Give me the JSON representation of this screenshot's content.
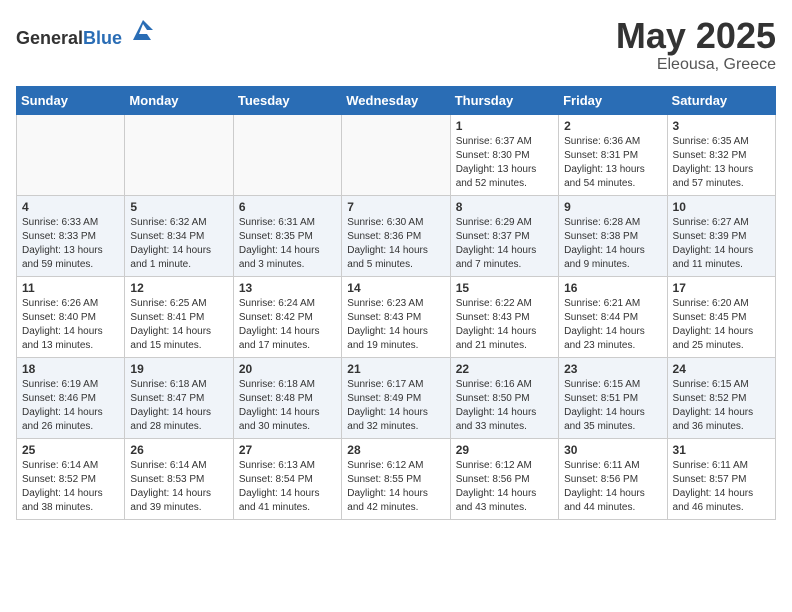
{
  "header": {
    "logo_general": "General",
    "logo_blue": "Blue",
    "month_year": "May 2025",
    "location": "Eleousa, Greece"
  },
  "days_of_week": [
    "Sunday",
    "Monday",
    "Tuesday",
    "Wednesday",
    "Thursday",
    "Friday",
    "Saturday"
  ],
  "weeks": [
    [
      {
        "day": "",
        "info": ""
      },
      {
        "day": "",
        "info": ""
      },
      {
        "day": "",
        "info": ""
      },
      {
        "day": "",
        "info": ""
      },
      {
        "day": "1",
        "info": "Sunrise: 6:37 AM\nSunset: 8:30 PM\nDaylight: 13 hours\nand 52 minutes."
      },
      {
        "day": "2",
        "info": "Sunrise: 6:36 AM\nSunset: 8:31 PM\nDaylight: 13 hours\nand 54 minutes."
      },
      {
        "day": "3",
        "info": "Sunrise: 6:35 AM\nSunset: 8:32 PM\nDaylight: 13 hours\nand 57 minutes."
      }
    ],
    [
      {
        "day": "4",
        "info": "Sunrise: 6:33 AM\nSunset: 8:33 PM\nDaylight: 13 hours\nand 59 minutes."
      },
      {
        "day": "5",
        "info": "Sunrise: 6:32 AM\nSunset: 8:34 PM\nDaylight: 14 hours\nand 1 minute."
      },
      {
        "day": "6",
        "info": "Sunrise: 6:31 AM\nSunset: 8:35 PM\nDaylight: 14 hours\nand 3 minutes."
      },
      {
        "day": "7",
        "info": "Sunrise: 6:30 AM\nSunset: 8:36 PM\nDaylight: 14 hours\nand 5 minutes."
      },
      {
        "day": "8",
        "info": "Sunrise: 6:29 AM\nSunset: 8:37 PM\nDaylight: 14 hours\nand 7 minutes."
      },
      {
        "day": "9",
        "info": "Sunrise: 6:28 AM\nSunset: 8:38 PM\nDaylight: 14 hours\nand 9 minutes."
      },
      {
        "day": "10",
        "info": "Sunrise: 6:27 AM\nSunset: 8:39 PM\nDaylight: 14 hours\nand 11 minutes."
      }
    ],
    [
      {
        "day": "11",
        "info": "Sunrise: 6:26 AM\nSunset: 8:40 PM\nDaylight: 14 hours\nand 13 minutes."
      },
      {
        "day": "12",
        "info": "Sunrise: 6:25 AM\nSunset: 8:41 PM\nDaylight: 14 hours\nand 15 minutes."
      },
      {
        "day": "13",
        "info": "Sunrise: 6:24 AM\nSunset: 8:42 PM\nDaylight: 14 hours\nand 17 minutes."
      },
      {
        "day": "14",
        "info": "Sunrise: 6:23 AM\nSunset: 8:43 PM\nDaylight: 14 hours\nand 19 minutes."
      },
      {
        "day": "15",
        "info": "Sunrise: 6:22 AM\nSunset: 8:43 PM\nDaylight: 14 hours\nand 21 minutes."
      },
      {
        "day": "16",
        "info": "Sunrise: 6:21 AM\nSunset: 8:44 PM\nDaylight: 14 hours\nand 23 minutes."
      },
      {
        "day": "17",
        "info": "Sunrise: 6:20 AM\nSunset: 8:45 PM\nDaylight: 14 hours\nand 25 minutes."
      }
    ],
    [
      {
        "day": "18",
        "info": "Sunrise: 6:19 AM\nSunset: 8:46 PM\nDaylight: 14 hours\nand 26 minutes."
      },
      {
        "day": "19",
        "info": "Sunrise: 6:18 AM\nSunset: 8:47 PM\nDaylight: 14 hours\nand 28 minutes."
      },
      {
        "day": "20",
        "info": "Sunrise: 6:18 AM\nSunset: 8:48 PM\nDaylight: 14 hours\nand 30 minutes."
      },
      {
        "day": "21",
        "info": "Sunrise: 6:17 AM\nSunset: 8:49 PM\nDaylight: 14 hours\nand 32 minutes."
      },
      {
        "day": "22",
        "info": "Sunrise: 6:16 AM\nSunset: 8:50 PM\nDaylight: 14 hours\nand 33 minutes."
      },
      {
        "day": "23",
        "info": "Sunrise: 6:15 AM\nSunset: 8:51 PM\nDaylight: 14 hours\nand 35 minutes."
      },
      {
        "day": "24",
        "info": "Sunrise: 6:15 AM\nSunset: 8:52 PM\nDaylight: 14 hours\nand 36 minutes."
      }
    ],
    [
      {
        "day": "25",
        "info": "Sunrise: 6:14 AM\nSunset: 8:52 PM\nDaylight: 14 hours\nand 38 minutes."
      },
      {
        "day": "26",
        "info": "Sunrise: 6:14 AM\nSunset: 8:53 PM\nDaylight: 14 hours\nand 39 minutes."
      },
      {
        "day": "27",
        "info": "Sunrise: 6:13 AM\nSunset: 8:54 PM\nDaylight: 14 hours\nand 41 minutes."
      },
      {
        "day": "28",
        "info": "Sunrise: 6:12 AM\nSunset: 8:55 PM\nDaylight: 14 hours\nand 42 minutes."
      },
      {
        "day": "29",
        "info": "Sunrise: 6:12 AM\nSunset: 8:56 PM\nDaylight: 14 hours\nand 43 minutes."
      },
      {
        "day": "30",
        "info": "Sunrise: 6:11 AM\nSunset: 8:56 PM\nDaylight: 14 hours\nand 44 minutes."
      },
      {
        "day": "31",
        "info": "Sunrise: 6:11 AM\nSunset: 8:57 PM\nDaylight: 14 hours\nand 46 minutes."
      }
    ]
  ]
}
